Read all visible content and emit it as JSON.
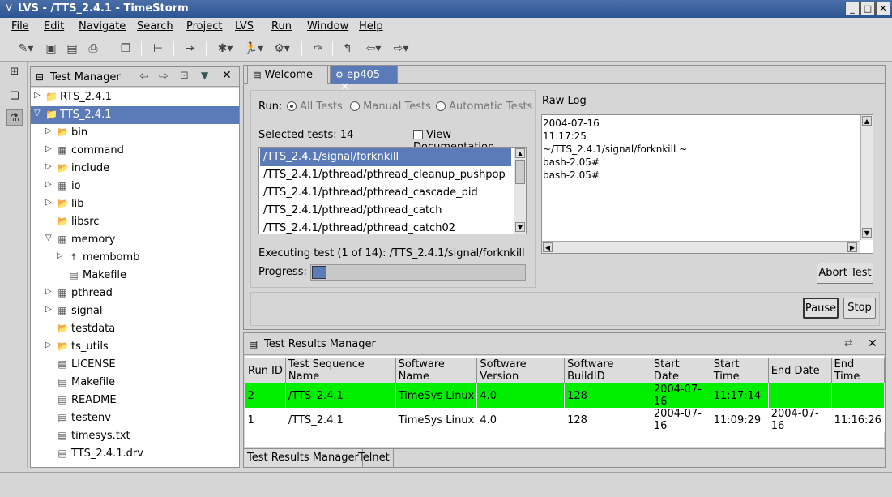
{
  "window": {
    "title": "LVS - /TTS_2.4.1 - TimeStorm"
  },
  "menu": [
    "File",
    "Edit",
    "Navigate",
    "Search",
    "Project",
    "LVS",
    "Run",
    "Window",
    "Help"
  ],
  "test_manager": {
    "title": "Test Manager",
    "tree": [
      {
        "label": "RTS_2.4.1",
        "indent": 0,
        "arrow": "▷",
        "icon": "project-icon",
        "selected": false
      },
      {
        "label": "TTS_2.4.1",
        "indent": 0,
        "arrow": "▽",
        "icon": "project-icon",
        "selected": true
      },
      {
        "label": "bin",
        "indent": 1,
        "arrow": "▷",
        "icon": "folder-icon",
        "selected": false
      },
      {
        "label": "command",
        "indent": 1,
        "arrow": "▷",
        "icon": "package-icon",
        "selected": false
      },
      {
        "label": "include",
        "indent": 1,
        "arrow": "▷",
        "icon": "folder-icon",
        "selected": false
      },
      {
        "label": "io",
        "indent": 1,
        "arrow": "▷",
        "icon": "package-icon",
        "selected": false
      },
      {
        "label": "lib",
        "indent": 1,
        "arrow": "▷",
        "icon": "folder-icon",
        "selected": false
      },
      {
        "label": "libsrc",
        "indent": 1,
        "arrow": "",
        "icon": "folder-icon",
        "selected": false
      },
      {
        "label": "memory",
        "indent": 1,
        "arrow": "▽",
        "icon": "package-icon",
        "selected": false
      },
      {
        "label": "membomb",
        "indent": 2,
        "arrow": "▷",
        "icon": "runner-icon",
        "selected": false
      },
      {
        "label": "Makefile",
        "indent": 2,
        "arrow": "",
        "icon": "file-icon",
        "selected": false
      },
      {
        "label": "pthread",
        "indent": 1,
        "arrow": "▷",
        "icon": "package-icon",
        "selected": false
      },
      {
        "label": "signal",
        "indent": 1,
        "arrow": "▷",
        "icon": "package-icon",
        "selected": false
      },
      {
        "label": "testdata",
        "indent": 1,
        "arrow": "",
        "icon": "folder-icon",
        "selected": false
      },
      {
        "label": "ts_utils",
        "indent": 1,
        "arrow": "▷",
        "icon": "folder-icon",
        "selected": false
      },
      {
        "label": "LICENSE",
        "indent": 1,
        "arrow": "",
        "icon": "file-icon",
        "selected": false
      },
      {
        "label": "Makefile",
        "indent": 1,
        "arrow": "",
        "icon": "file-icon",
        "selected": false
      },
      {
        "label": "README",
        "indent": 1,
        "arrow": "",
        "icon": "file-icon",
        "selected": false
      },
      {
        "label": "testenv",
        "indent": 1,
        "arrow": "",
        "icon": "file-icon",
        "selected": false
      },
      {
        "label": "timesys.txt",
        "indent": 1,
        "arrow": "",
        "icon": "file-icon",
        "selected": false
      },
      {
        "label": "TTS_2.4.1.drv",
        "indent": 1,
        "arrow": "",
        "icon": "file-icon",
        "selected": false
      }
    ]
  },
  "tabs": {
    "welcome": "Welcome",
    "ep405": "ep405"
  },
  "run": {
    "label": "Run:",
    "all": "All Tests",
    "manual": "Manual Tests",
    "automatic": "Automatic Tests",
    "selected": "Selected tests: 14",
    "view_doc": "View Documentation",
    "tests": [
      "/TTS_2.4.1/signal/forknkill",
      "/TTS_2.4.1/pthread/pthread_cleanup_pushpop",
      "/TTS_2.4.1/pthread/pthread_cascade_pid",
      "/TTS_2.4.1/pthread/pthread_catch",
      "/TTS_2.4.1/pthread/pthread_catch02"
    ],
    "executing": "Executing test (1 of 14): /TTS_2.4.1/signal/forknkill",
    "progress_label": "Progress:",
    "progress_fraction": 0.07
  },
  "raw_log": {
    "title": "Raw Log",
    "lines": [
      "2004-07-16",
      "11:17:25",
      "~/TTS_2.4.1/signal/forknkill ~",
      "bash-2.05#",
      "bash-2.05#"
    ]
  },
  "buttons": {
    "abort": "Abort Test",
    "pause": "Pause",
    "stop": "Stop"
  },
  "results": {
    "title": "Test Results Manager",
    "columns": [
      "Run ID",
      "Test Sequence Name",
      "Software Name",
      "Software Version",
      "Software BuildID",
      "Start Date",
      "Start Time",
      "End Date",
      "End Time"
    ],
    "rows": [
      [
        "2",
        "/TTS_2.4.1",
        "TimeSys Linux",
        "4.0",
        "128",
        "2004-07-16",
        "11:17:14",
        "",
        ""
      ],
      [
        "1",
        "/TTS_2.4.1",
        "TimeSys Linux",
        "4.0",
        "128",
        "2004-07-16",
        "11:09:29",
        "2004-07-16",
        "11:16:26"
      ]
    ],
    "highlight_color": "#00ee00"
  },
  "bottom_tabs": [
    "Test Results Manager",
    "Telnet"
  ],
  "colors": {
    "selection": "#5b7ab8",
    "titlebar": "#2e5594"
  }
}
